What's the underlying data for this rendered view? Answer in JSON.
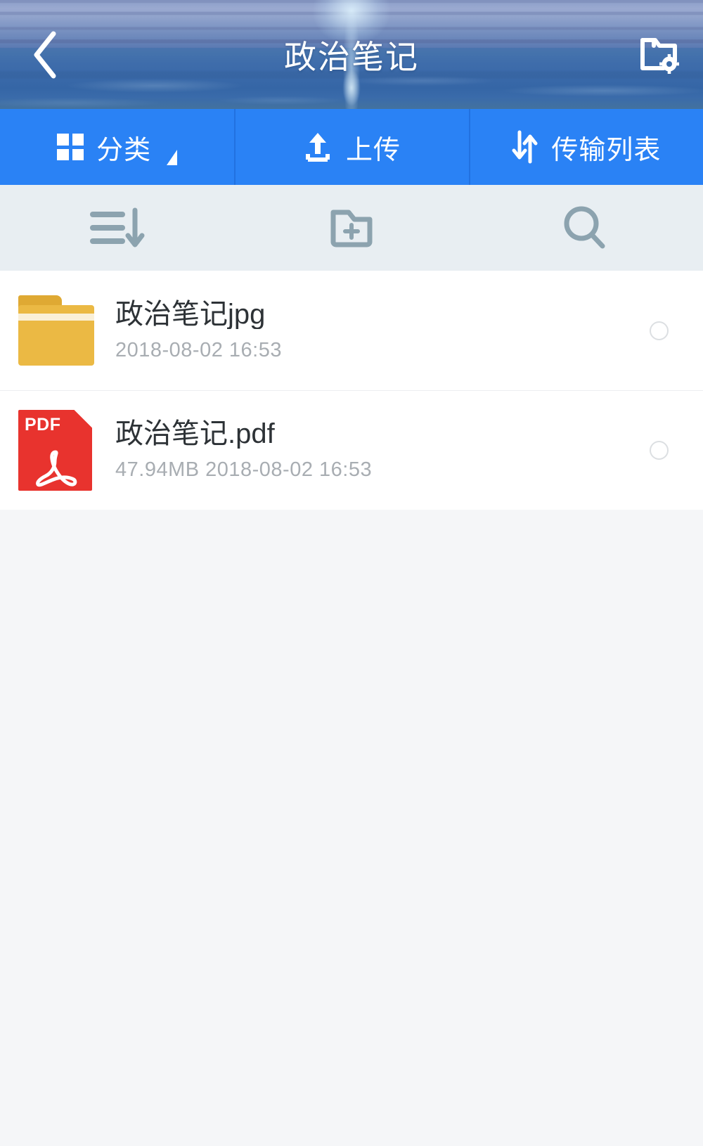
{
  "header": {
    "title": "政治笔记",
    "back_icon": "chevron-left-icon",
    "action_icon": "folder-settings-icon"
  },
  "toolbar": {
    "items": [
      {
        "label": "分类",
        "icon": "grid-icon",
        "has_caret": true
      },
      {
        "label": "上传",
        "icon": "upload-icon",
        "has_caret": false
      },
      {
        "label": "传输列表",
        "icon": "transfer-icon",
        "has_caret": false
      }
    ],
    "background": "#2a82f5"
  },
  "subbar": {
    "items": [
      {
        "name": "sort-icon"
      },
      {
        "name": "new-folder-icon"
      },
      {
        "name": "search-icon"
      }
    ],
    "background": "#e8eef2",
    "icon_color": "#8ca3af"
  },
  "file_list": {
    "rows": [
      {
        "name": "政治笔记jpg",
        "meta": "2018-08-02  16:53",
        "size": "",
        "date": "2018-08-02",
        "time": "16:53",
        "type": "folder",
        "icon": "folder-icon",
        "icon_color": "#ebb944",
        "selected": false
      },
      {
        "name": "政治笔记.pdf",
        "meta": "47.94MB  2018-08-02  16:53",
        "size": "47.94MB",
        "date": "2018-08-02",
        "time": "16:53",
        "type": "pdf",
        "icon": "pdf-file-icon",
        "icon_color": "#e8332e",
        "icon_label": "PDF",
        "selected": false
      }
    ]
  },
  "colors": {
    "accent": "#2a82f5",
    "subbar_bg": "#e8eef2",
    "page_bg": "#f5f6f8",
    "list_bg": "#ffffff",
    "folder": "#ebb944",
    "pdf": "#e8332e",
    "meta_text": "#a8adb2",
    "name_text": "#2d3236"
  }
}
